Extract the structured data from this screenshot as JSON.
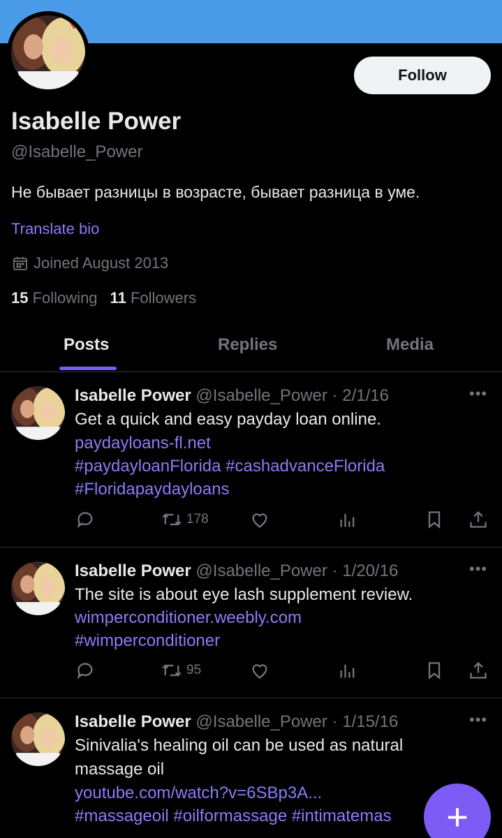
{
  "profile": {
    "name": "Isabelle Power",
    "handle": "@Isabelle_Power",
    "bio": "Не бывает разницы в возрасте, бывает разница в уме.",
    "translate_label": "Translate bio",
    "joined": "Joined August 2013",
    "following_count": "15",
    "following_label": "Following",
    "followers_count": "11",
    "followers_label": "Followers",
    "follow_button": "Follow"
  },
  "tabs": [
    {
      "label": "Posts",
      "active": true
    },
    {
      "label": "Replies",
      "active": false
    },
    {
      "label": "Media",
      "active": false
    }
  ],
  "posts": [
    {
      "author": "Isabelle Power",
      "handle": "@Isabelle_Power",
      "date": "2/1/16",
      "text": "Get a quick and easy payday loan online.",
      "link": "paydayloans-fl.net",
      "hashtags_1": "#paydayloanFlorida #cashadvanceFlorida",
      "hashtags_2": "#Floridapaydayloans",
      "reposts": "178"
    },
    {
      "author": "Isabelle Power",
      "handle": "@Isabelle_Power",
      "date": "1/20/16",
      "text": "The site is about eye lash supplement review.",
      "link": "wimperconditioner.weebly.com",
      "hashtags_1": "#wimperconditioner",
      "reposts": "95"
    },
    {
      "author": "Isabelle Power",
      "handle": "@Isabelle_Power",
      "date": "1/15/16",
      "text_1": "Sinivalia's healing oil can be used as natural",
      "text_2": "massage oil",
      "link": "youtube.com/watch?v=6SBp3A...",
      "hashtags_1": "#massageoil #oilformassage #intimatemas"
    }
  ],
  "colors": {
    "background": "#000000",
    "banner": "#4a9be8",
    "accent": "#7c5cf5",
    "link": "#8b7cf8",
    "muted": "#71767b",
    "text": "#e7e9ea"
  },
  "icons": [
    "calendar-icon",
    "reply-icon",
    "repost-icon",
    "like-icon",
    "views-icon",
    "bookmark-icon",
    "share-icon",
    "more-icon",
    "compose-plus-icon"
  ]
}
